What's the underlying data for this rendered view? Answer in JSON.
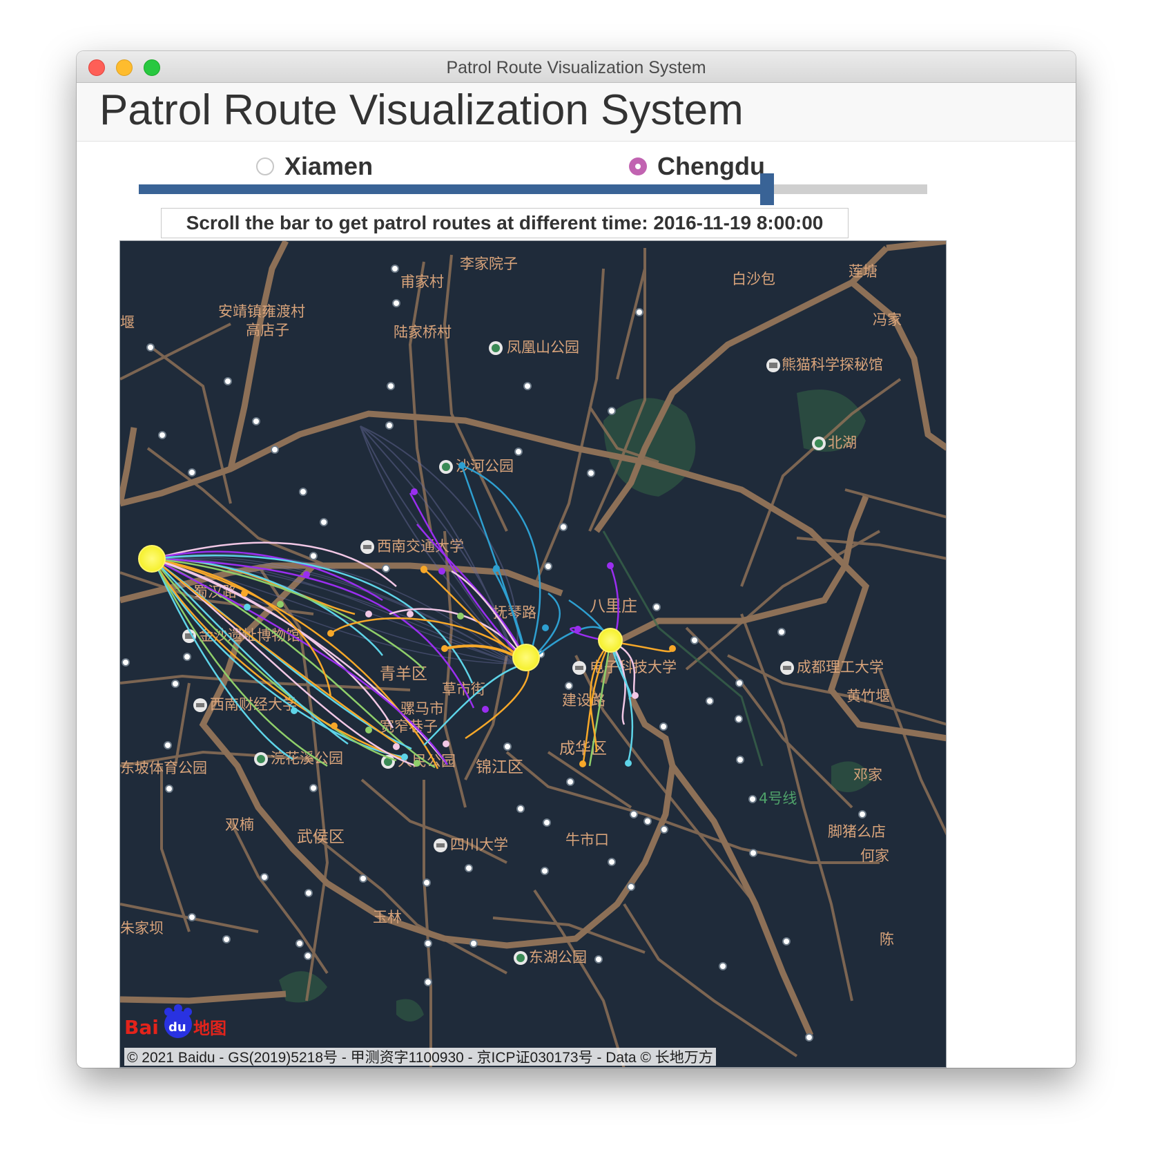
{
  "window": {
    "title": "Patrol Route Visualization System"
  },
  "header": {
    "title": "Patrol Route Visualization System"
  },
  "city_selector": {
    "options": [
      {
        "label": "Xiamen",
        "selected": false
      },
      {
        "label": "Chengdu",
        "selected": true
      }
    ]
  },
  "time_slider": {
    "value_fraction": 0.79,
    "fill_color": "#396396",
    "track_color": "#cfcfcf"
  },
  "time_label": "Scroll the bar to get patrol routes at different time: 2016-11-19 8:00:00",
  "map": {
    "logo": {
      "text_a": "Bai",
      "text_b": "du",
      "text_c": "地图"
    },
    "copyright": "© 2021 Baidu - GS(2019)5218号 - 甲测资字1100930 - 京ICP证030173号 - Data © 长地万方",
    "labels": [
      "李家院子",
      "甫家村",
      "白沙包",
      "莲塘",
      "安靖镇雍渡村",
      "高店子",
      "堰",
      "陆家桥村",
      "凤凰山公园",
      "冯家",
      "熊猫科学探秘馆",
      "北湖",
      "沙河公园",
      "西南交通大学",
      "蜀汉路",
      "八里庄",
      "金沙遗址博物馆",
      "抚琴路",
      "电子科技大学",
      "成都理工大学",
      "青羊区",
      "草市街",
      "黄竹堰",
      "西南财经大学",
      "骡马市",
      "建设路",
      "宽窄巷子",
      "成华区",
      "东坡体育公园",
      "浣花溪公园",
      "人民公园",
      "锦江区",
      "邓家",
      "4号线",
      "双楠",
      "武侯区",
      "四川大学",
      "牛市口",
      "脚猪么店",
      "何家",
      "玉林",
      "东湖公园",
      "朱家坝",
      "陈"
    ],
    "colors": {
      "background": "#1f2b3a",
      "road": "#8d7057",
      "label": "#d9a47b",
      "hub": "#f5f02a"
    }
  }
}
